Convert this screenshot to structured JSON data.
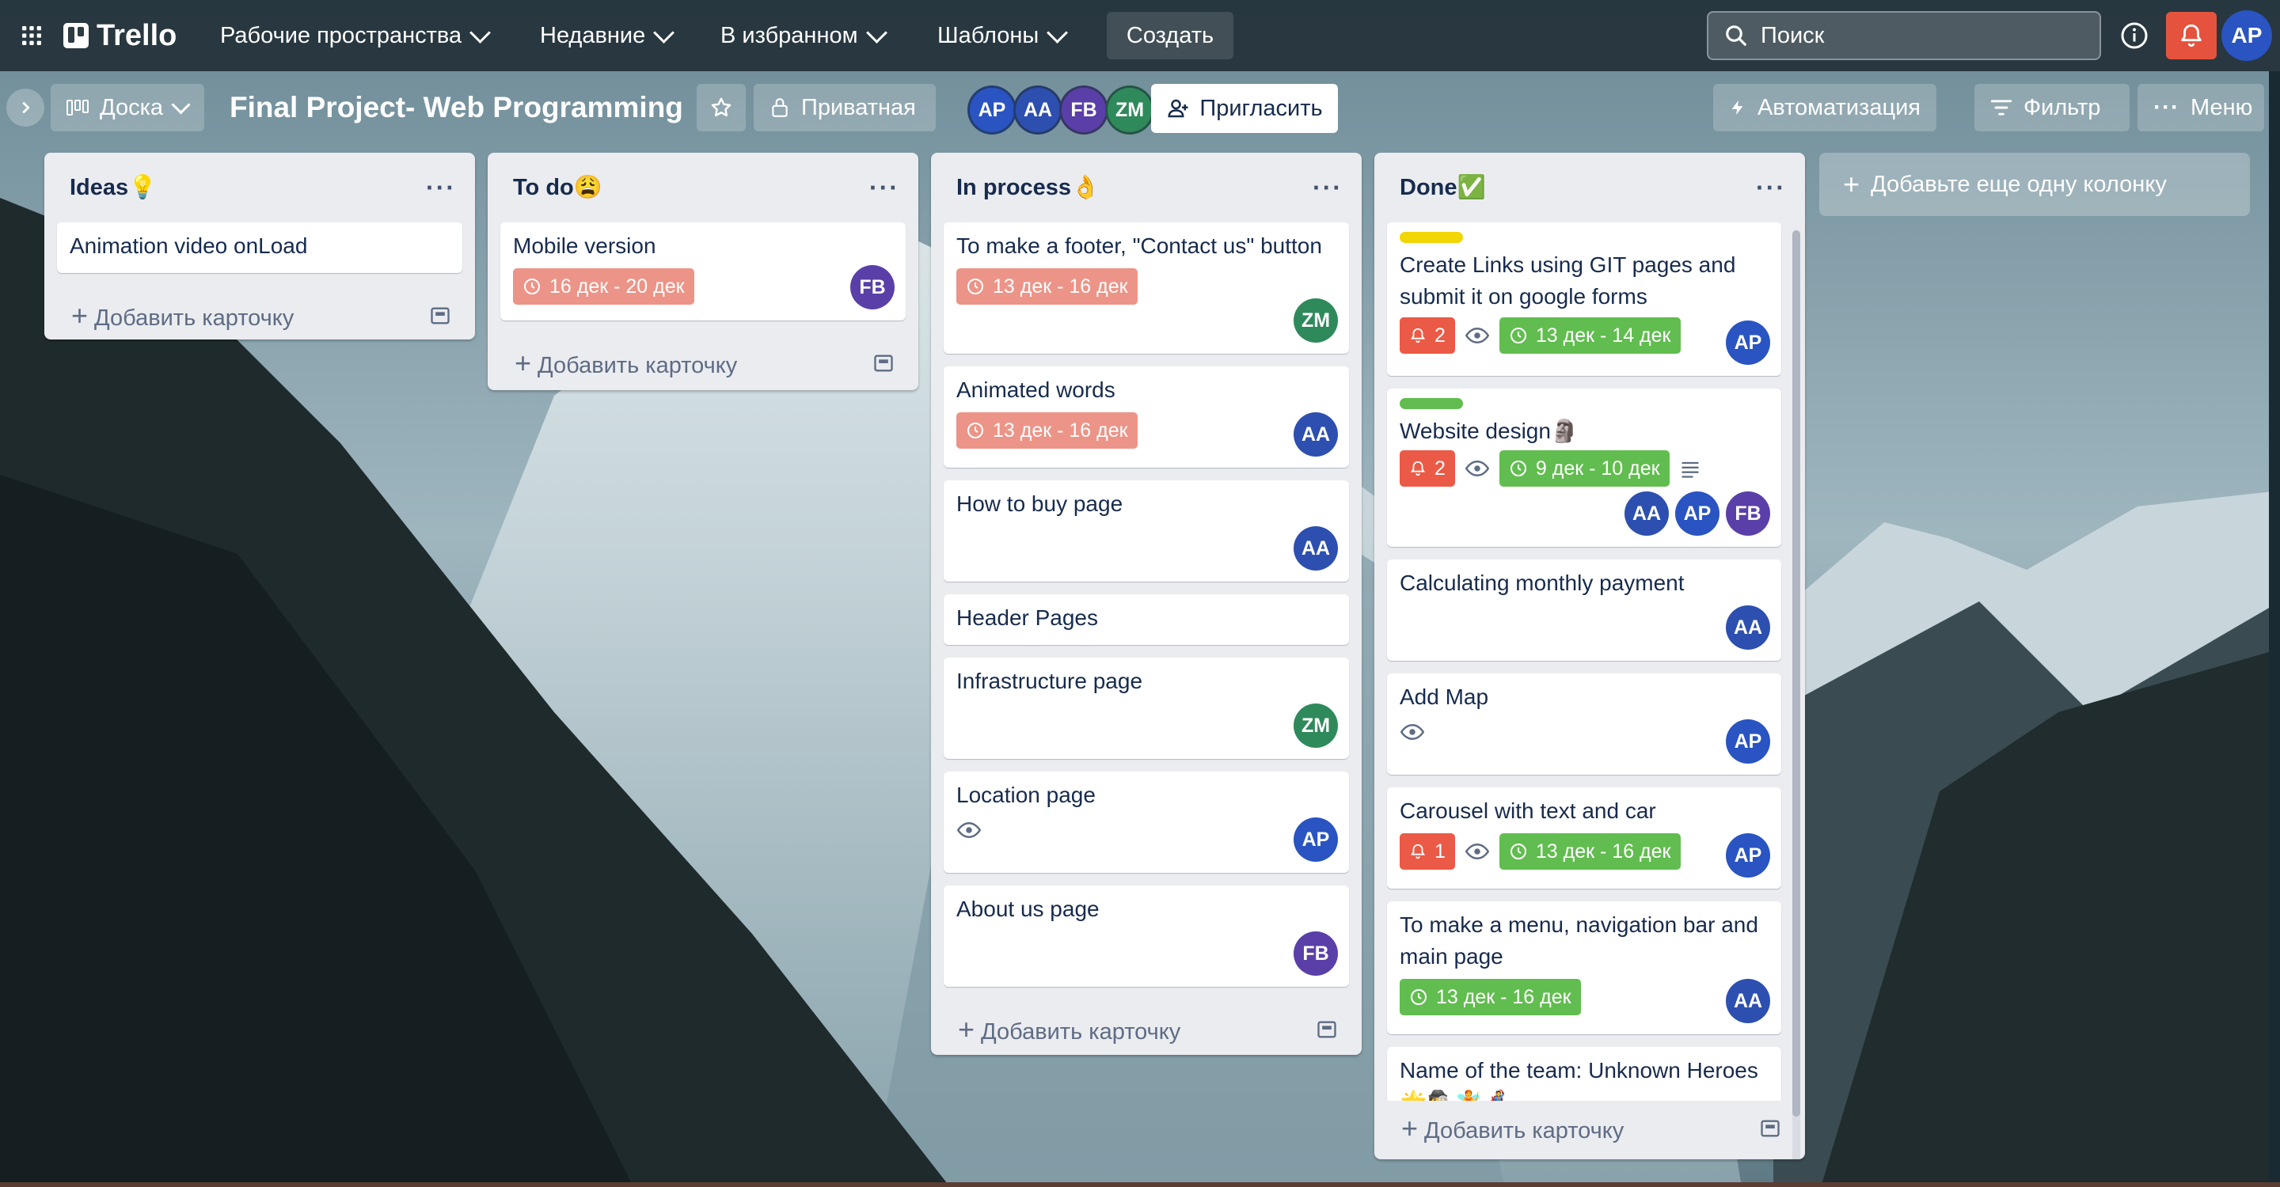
{
  "topbar": {
    "logo": "Trello",
    "menus": [
      "Рабочие пространства",
      "Недавние",
      "В избранном",
      "Шаблоны"
    ],
    "create_label": "Создать",
    "search_placeholder": "Поиск",
    "user_initials": "AP"
  },
  "board": {
    "view_label": "Доска",
    "title": "Final Project- Web Programming",
    "visibility_label": "Приватная",
    "members": [
      "AP",
      "AA",
      "FB",
      "ZM"
    ],
    "invite_label": "Пригласить",
    "automation_label": "Автоматизация",
    "filter_label": "Фильтр",
    "menu_label": "Меню"
  },
  "add_card_label": "Добавить карточку",
  "add_list_label": "Добавьте еще одну колонку",
  "colors": {
    "accent": "#579dff",
    "due_soft": "#ec9488",
    "due_complete": "#61bd4f",
    "notification": "#eb5a46",
    "label_yellow": "#f2d600",
    "label_green": "#61bd4f"
  },
  "lists": [
    {
      "title": "Ideas💡",
      "cards": [
        {
          "title": "Animation video onLoad"
        }
      ]
    },
    {
      "title": "To do😩",
      "cards": [
        {
          "title": "Mobile version",
          "due": "16 дек - 20 дек",
          "due_style": "red-soft",
          "members": [
            "FB"
          ]
        }
      ]
    },
    {
      "title": "In process👌",
      "cards": [
        {
          "title": "To make a footer, \"Contact us\" button",
          "due": "13 дек - 16 дек",
          "due_style": "red-soft",
          "members": [
            "ZM"
          ]
        },
        {
          "title": "Animated words",
          "due": "13 дек - 16 дек",
          "due_style": "red-soft",
          "members": [
            "AA"
          ]
        },
        {
          "title": "How to buy page",
          "members": [
            "AA"
          ]
        },
        {
          "title": "Header Pages"
        },
        {
          "title": "Infrastructure page",
          "members": [
            "ZM"
          ]
        },
        {
          "title": "Location page",
          "watch": true,
          "members": [
            "AP"
          ]
        },
        {
          "title": "About us page",
          "members": [
            "FB"
          ]
        }
      ]
    },
    {
      "title": "Done✅",
      "cards": [
        {
          "title": "Create Links using GIT pages and submit it on google forms",
          "label": "yellow",
          "notifications": "2",
          "watch": true,
          "due": "13 дек - 14 дек",
          "due_style": "green",
          "members": [
            "AP"
          ]
        },
        {
          "title": "Website design🗿",
          "label": "green",
          "notifications": "2",
          "watch": true,
          "due": "9 дек - 10 дек",
          "due_style": "green",
          "description": true,
          "members": [
            "AA",
            "AP",
            "FB"
          ]
        },
        {
          "title": "Calculating monthly payment",
          "members": [
            "AA"
          ]
        },
        {
          "title": "Add Map",
          "watch": true,
          "members": [
            "AP"
          ]
        },
        {
          "title": "Carousel with text and car",
          "notifications": "1",
          "watch": true,
          "due": "13 дек - 16 дек",
          "due_style": "green",
          "members": [
            "AP"
          ]
        },
        {
          "title": "To make a menu, navigation bar and main page",
          "due": "13 дек - 16 дек",
          "due_style": "green",
          "members": [
            "AA"
          ]
        },
        {
          "title": "Name of the team: Unknown Heroes 🌟🕵️🧚🦸"
        }
      ]
    }
  ]
}
